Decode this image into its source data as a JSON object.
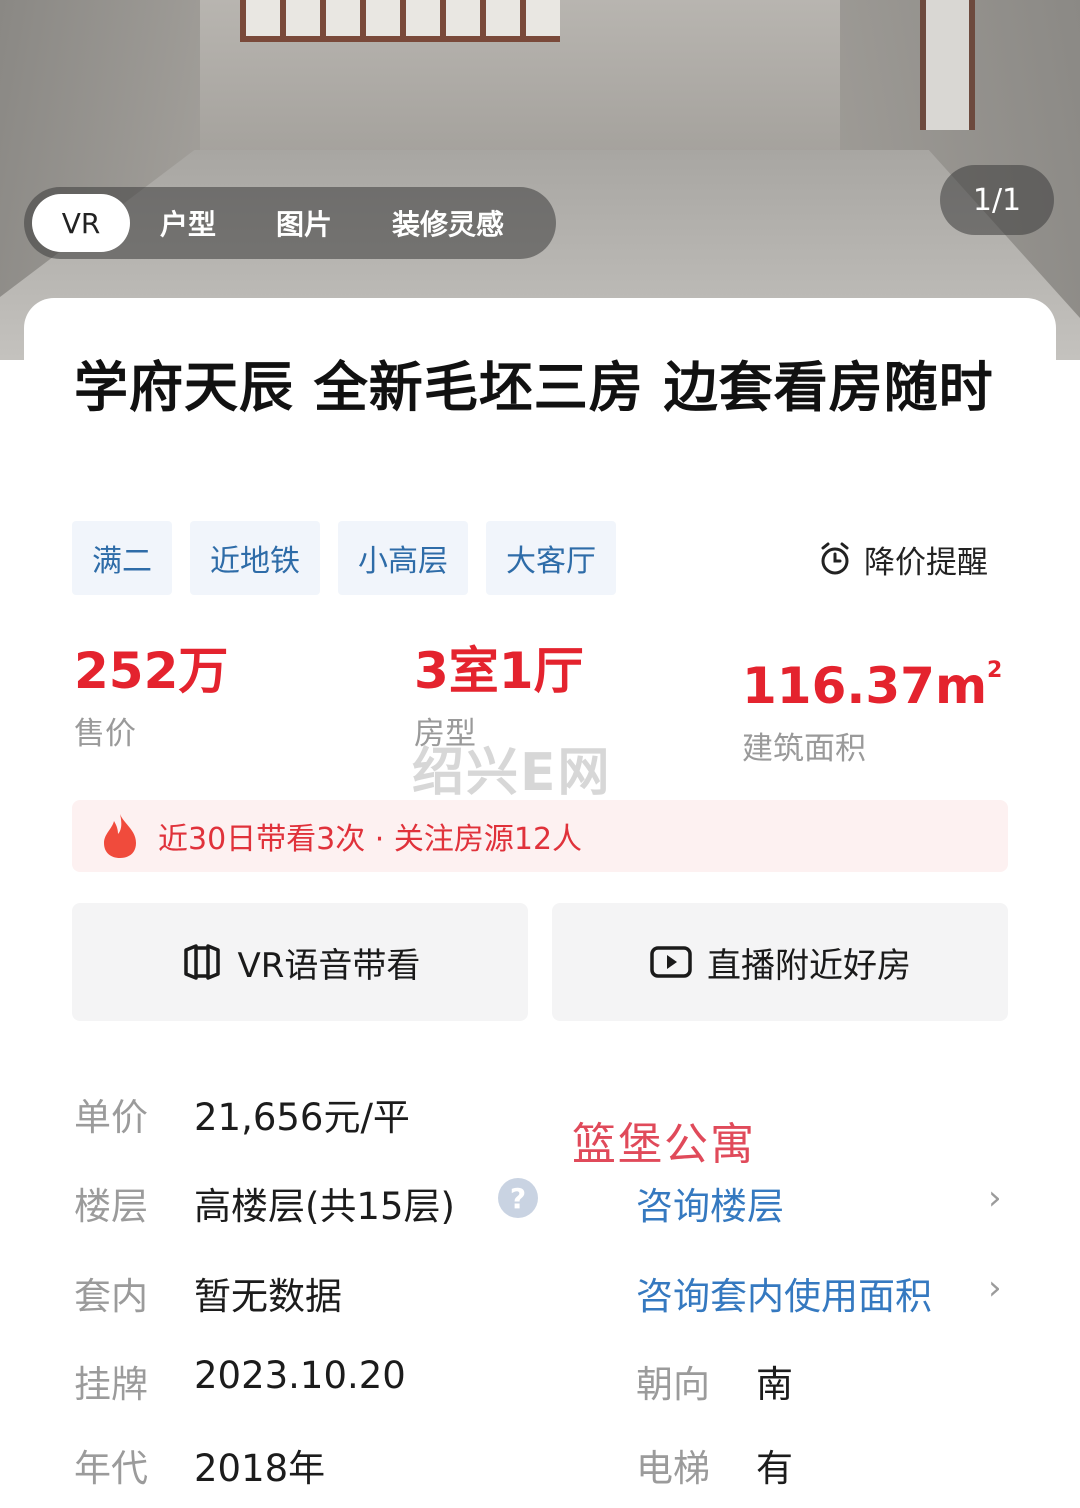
{
  "media": {
    "tabs": [
      "VR",
      "户型",
      "图片",
      "装修灵感"
    ],
    "active_tab": "VR",
    "counter": "1/1"
  },
  "listing": {
    "title": "学府天辰  全新毛坯三房 边套看房随时",
    "tags": [
      "满二",
      "近地铁",
      "小高层",
      "大客厅"
    ],
    "price_alert": "降价提醒",
    "stats": [
      {
        "value": "252万",
        "label": "售价"
      },
      {
        "value": "3室1厅",
        "label": "房型"
      },
      {
        "value": "116.37m",
        "sup": "2",
        "label": "建筑面积"
      }
    ],
    "watermark": "绍兴E网",
    "hot_text": "近30日带看3次 · 关注房源12人",
    "buttons": {
      "vr_guide": "VR语音带看",
      "live_nearby": "直播附近好房"
    },
    "details": {
      "unit_price_label": "单价",
      "unit_price": "21,656元/平",
      "floor_label": "楼层",
      "floor": "高楼层(共15层)",
      "floor_link": "咨询楼层",
      "inner_label": "套内",
      "inner": "暂无数据",
      "inner_link": "咨询套内使用面积",
      "listed_label": "挂牌",
      "listed": "2023.10.20",
      "orientation_label": "朝向",
      "orientation": "南",
      "year_label": "年代",
      "year": "2018年",
      "elevator_label": "电梯",
      "elevator": "有"
    },
    "overlay_brand": "篮堡公寓"
  },
  "colors": {
    "price_red": "#e4232e",
    "tag_blue": "#2e6ca8",
    "link_blue": "#3579c0",
    "hot_red": "#e0323b"
  }
}
